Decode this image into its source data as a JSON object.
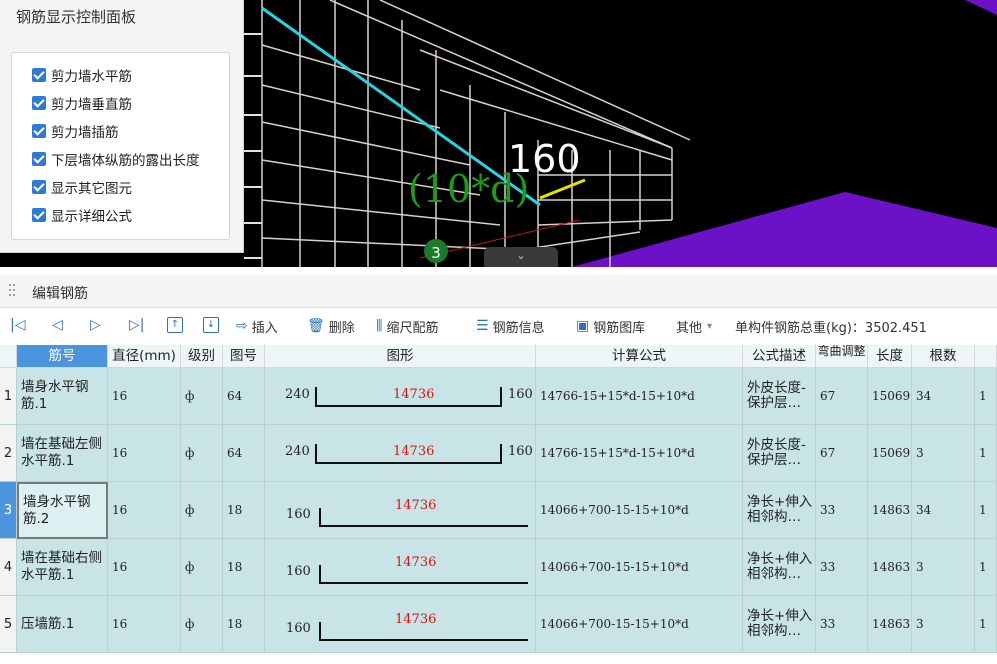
{
  "panel": {
    "title": "钢筋显示控制面板",
    "options": [
      {
        "label": "剪力墙水平筋",
        "checked": true
      },
      {
        "label": "剪力墙垂直筋",
        "checked": true
      },
      {
        "label": "剪力墙插筋",
        "checked": true
      },
      {
        "label": "下层墙体纵筋的露出长度",
        "checked": true
      },
      {
        "label": "显示其它图元",
        "checked": true
      },
      {
        "label": "显示详细公式",
        "checked": true
      }
    ]
  },
  "viewport": {
    "dim_label": "160",
    "formula_label": "(10*d)",
    "marker_number": "3",
    "collapse_glyph": "⌄"
  },
  "editor": {
    "title": "编辑钢筋",
    "toolbar": {
      "insert": "插入",
      "delete": "删除",
      "scale": "缩尺配筋",
      "info": "钢筋信息",
      "library": "钢筋图库",
      "other": "其他",
      "total_weight": "单构件钢筋总重(kg)：3502.451"
    },
    "columns": [
      "筋号",
      "直径(mm)",
      "级别",
      "图号",
      "图形",
      "计算公式",
      "公式描述",
      "弯曲调整",
      "长度",
      "根数",
      ""
    ],
    "rows": [
      {
        "num": "1",
        "name": "墙身水平钢筋.1",
        "dia": "16",
        "grade": "ф",
        "fig": "64",
        "shape": {
          "type": "u",
          "left": "240",
          "mid": "14736",
          "right": "160"
        },
        "formula": "14766-15+15*d-15+10*d",
        "desc": "外皮长度-保护层…",
        "bend": "67",
        "length": "15069",
        "count": "34",
        "extra": "1"
      },
      {
        "num": "2",
        "name": "墙在基础左侧水平筋.1",
        "dia": "16",
        "grade": "ф",
        "fig": "64",
        "shape": {
          "type": "u",
          "left": "240",
          "mid": "14736",
          "right": "160"
        },
        "formula": "14766-15+15*d-15+10*d",
        "desc": "外皮长度-保护层…",
        "bend": "67",
        "length": "15069",
        "count": "3",
        "extra": "1"
      },
      {
        "num": "3",
        "name": "墙身水平钢筋.2",
        "dia": "16",
        "grade": "ф",
        "fig": "18",
        "shape": {
          "type": "l",
          "left": "160",
          "mid": "14736",
          "right": ""
        },
        "formula": "14066+700-15-15+10*d",
        "desc": "净长+伸入相邻构…",
        "bend": "33",
        "length": "14863",
        "count": "34",
        "extra": "1"
      },
      {
        "num": "4",
        "name": "墙在基础右侧水平筋.1",
        "dia": "16",
        "grade": "ф",
        "fig": "18",
        "shape": {
          "type": "l",
          "left": "160",
          "mid": "14736",
          "right": ""
        },
        "formula": "14066+700-15-15+10*d",
        "desc": "净长+伸入相邻构…",
        "bend": "33",
        "length": "14863",
        "count": "3",
        "extra": "1"
      },
      {
        "num": "5",
        "name": "压墙筋.1",
        "dia": "16",
        "grade": "ф",
        "fig": "18",
        "shape": {
          "type": "l",
          "left": "160",
          "mid": "14736",
          "right": ""
        },
        "formula": "14066+700-15-15+10*d",
        "desc": "净长+伸入相邻构…",
        "bend": "33",
        "length": "14863",
        "count": "3",
        "extra": "1"
      }
    ]
  },
  "colors": {
    "accent": "#4a95dd",
    "row_bg": "#c9e4e6",
    "viewport_bg": "#000000",
    "slab": "#6b12c9",
    "rebar_hl": "#29d3e0",
    "dim_green": "#1e9a1e",
    "dim_yellow": "#e8e000"
  }
}
